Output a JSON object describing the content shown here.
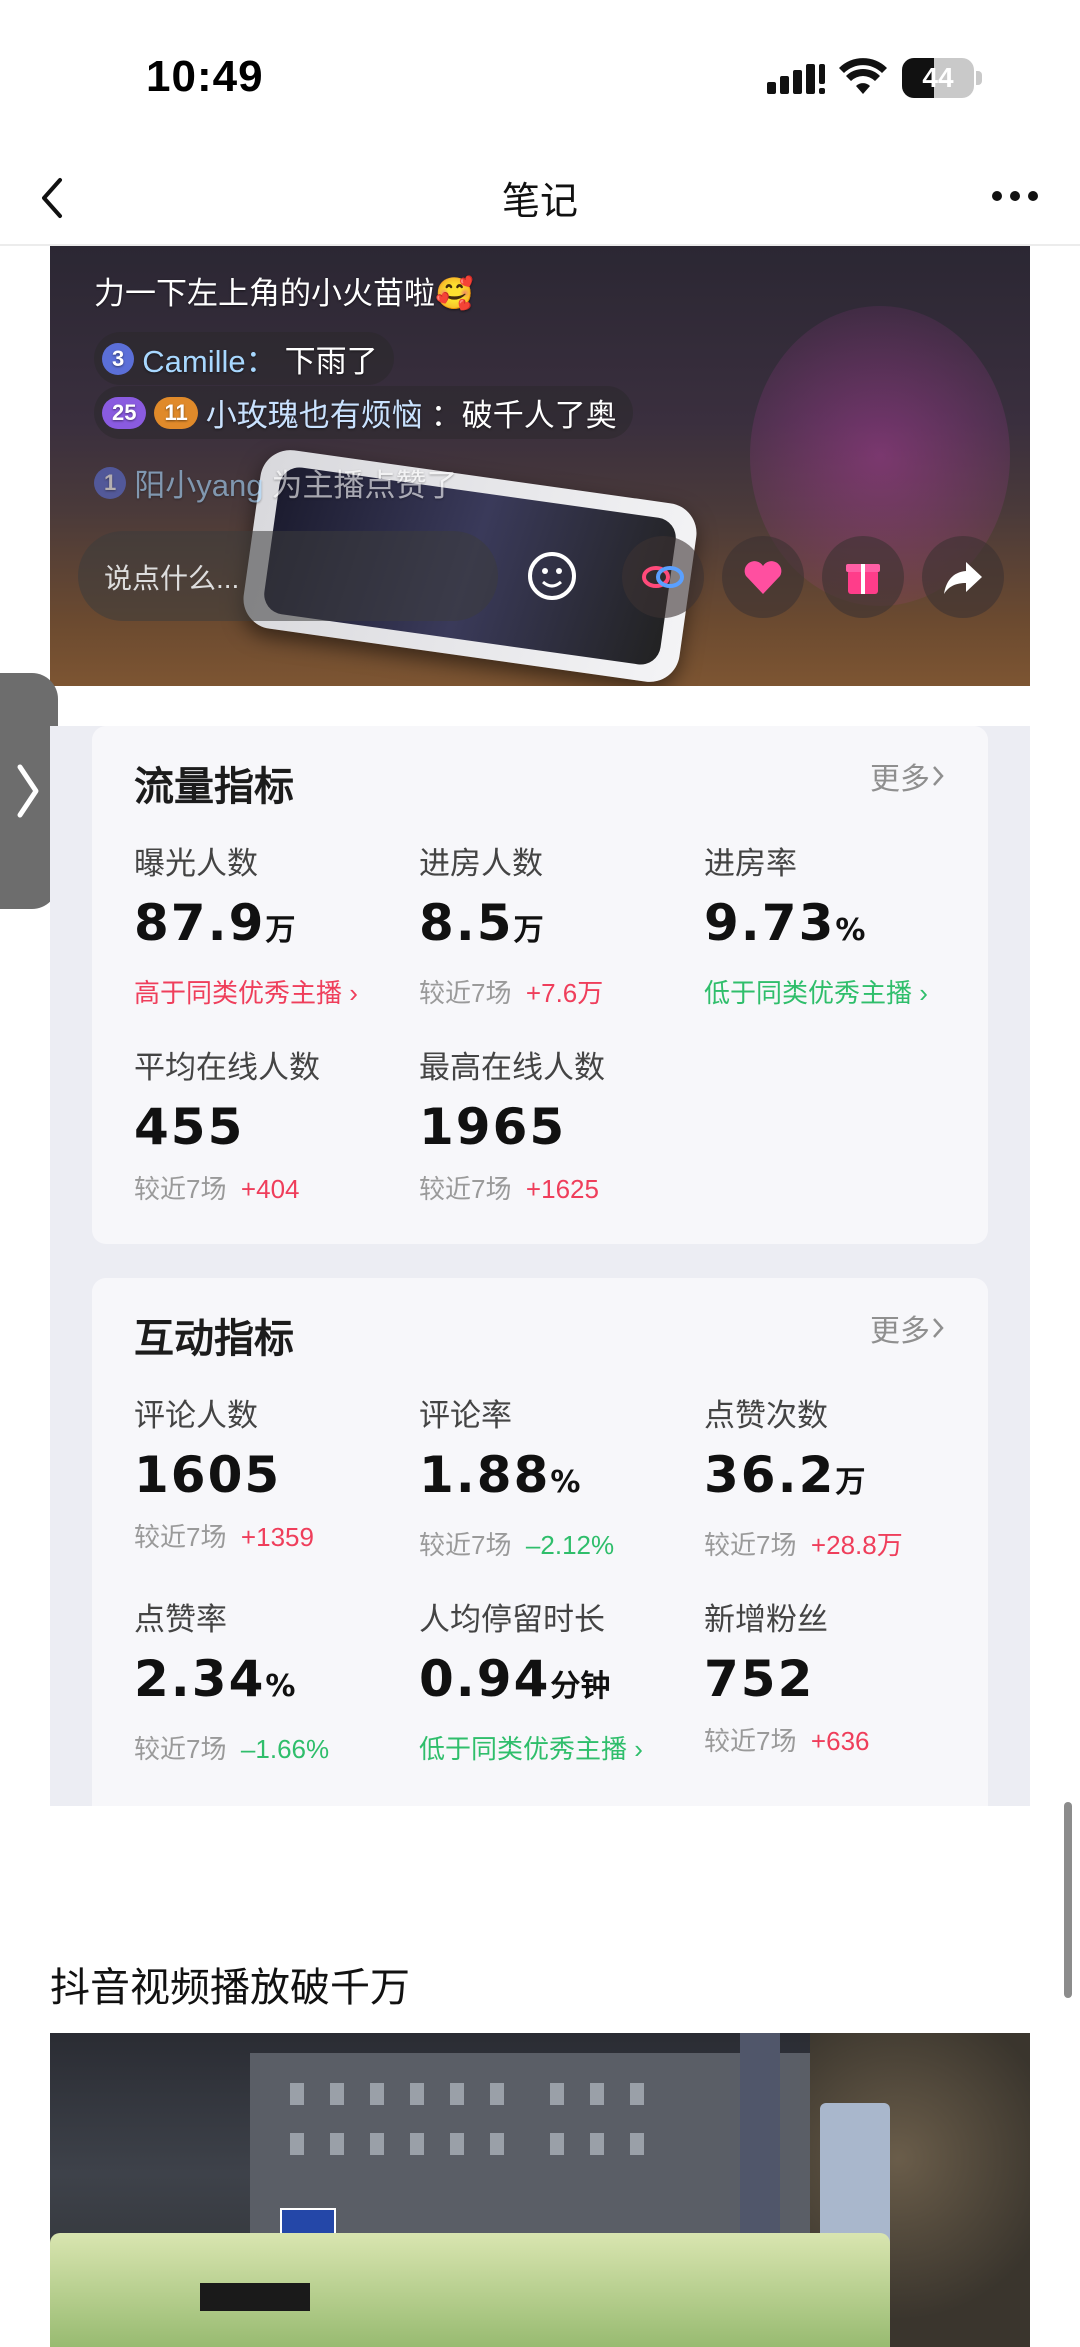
{
  "status_bar": {
    "time": "10:49",
    "battery": "44",
    "battery_level": 0.44
  },
  "nav": {
    "title": "笔记"
  },
  "live": {
    "chat": [
      {
        "text": "力一下左上角的小火苗啦🥰"
      },
      {
        "badge": "3",
        "name": "Camille：",
        "message": "下雨了"
      },
      {
        "badge": "25",
        "badge2": "11",
        "name": "小玫瑰也有烦恼",
        "message": "：破千人了奥"
      },
      {
        "badge": "1",
        "name": "阳小yang",
        "message": "为主播点赞了"
      }
    ],
    "input_placeholder": "说点什么..."
  },
  "traffic": {
    "title": "流量指标",
    "more": "更多",
    "metrics": [
      {
        "label": "曝光人数",
        "value": "87.9",
        "unit": "万",
        "hint": "高于同类优秀主播",
        "hint_type": "red"
      },
      {
        "label": "进房人数",
        "value": "8.5",
        "unit": "万",
        "compare_label": "较近7场",
        "change": "+7.6万",
        "change_type": "up"
      },
      {
        "label": "进房率",
        "value": "9.73",
        "unit": "%",
        "hint": "低于同类优秀主播",
        "hint_type": "green"
      },
      {
        "label": "平均在线人数",
        "value": "455",
        "unit": "",
        "compare_label": "较近7场",
        "change": "+404",
        "change_type": "up"
      },
      {
        "label": "最高在线人数",
        "value": "1965",
        "unit": "",
        "compare_label": "较近7场",
        "change": "+1625",
        "change_type": "up"
      }
    ]
  },
  "interaction": {
    "title": "互动指标",
    "more": "更多",
    "metrics": [
      {
        "label": "评论人数",
        "value": "1605",
        "unit": "",
        "compare_label": "较近7场",
        "change": "+1359",
        "change_type": "up"
      },
      {
        "label": "评论率",
        "value": "1.88",
        "unit": "%",
        "compare_label": "较近7场",
        "change": "–2.12%",
        "change_type": "down"
      },
      {
        "label": "点赞次数",
        "value": "36.2",
        "unit": "万",
        "compare_label": "较近7场",
        "change": "+28.8万",
        "change_type": "up"
      },
      {
        "label": "点赞率",
        "value": "2.34",
        "unit": "%",
        "compare_label": "较近7场",
        "change": "–1.66%",
        "change_type": "down"
      },
      {
        "label": "人均停留时长",
        "value": "0.94",
        "unit": "分钟",
        "hint": "低于同类优秀主播",
        "hint_type": "green"
      },
      {
        "label": "新增粉丝",
        "value": "752",
        "unit": "",
        "compare_label": "较近7场",
        "change": "+636",
        "change_type": "up"
      }
    ]
  },
  "next_section": {
    "title": "抖音视频播放破千万",
    "bus_sign": "",
    "street_sign": ""
  },
  "colors": {
    "up": "#ef3e5b",
    "down": "#2fbe6b",
    "card_bg": "#f7f7fa",
    "area_bg": "#ecedf3"
  }
}
